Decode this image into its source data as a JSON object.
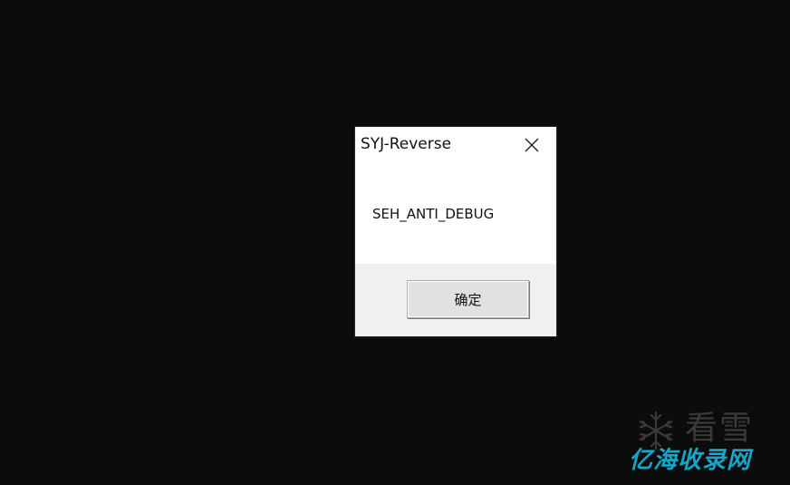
{
  "dialog": {
    "title": "SYJ-Reverse",
    "message": "SEH_ANTI_DEBUG",
    "ok_label": "确定",
    "close_icon": "close-icon"
  },
  "watermark": {
    "logo_icon": "snowflake-icon",
    "top_text": "看雪",
    "bottom_text": "亿海收录网",
    "top_color": "#3a3a3a",
    "bottom_color": "#13a7c9"
  },
  "colors": {
    "desktop_bg": "#0c0c0c",
    "dialog_bg": "#ffffff",
    "footer_bg": "#f0f0f0",
    "button_bg": "#e1e1e1"
  }
}
